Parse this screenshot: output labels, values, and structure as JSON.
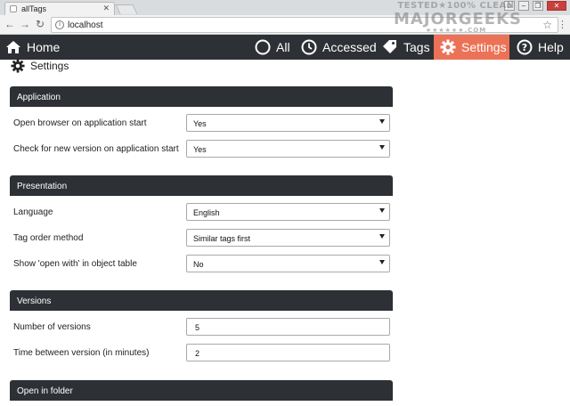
{
  "browser": {
    "tab_title": "allTags",
    "url": "localhost"
  },
  "watermark": {
    "line1": "TESTED★100% CLEAN",
    "line2": "MAJORGEEKS",
    "line3": "★★★★★★.COM"
  },
  "navbar": {
    "items": [
      {
        "label": "Home",
        "icon": "home-icon"
      },
      {
        "label": "All",
        "icon": "circle-icon"
      },
      {
        "label": "Accessed",
        "icon": "clock-icon"
      },
      {
        "label": "Tags",
        "icon": "tag-icon"
      },
      {
        "label": "Settings",
        "icon": "gear-icon",
        "active": true
      },
      {
        "label": "Help",
        "icon": "question-icon"
      }
    ],
    "active_color": "#ec7257",
    "bar_color": "#2d3035"
  },
  "page": {
    "title": "Settings"
  },
  "sections": {
    "application": {
      "title": "Application",
      "open_browser_label": "Open browser on application start",
      "open_browser_value": "Yes",
      "check_version_label": "Check for new version on application start",
      "check_version_value": "Yes"
    },
    "presentation": {
      "title": "Presentation",
      "language_label": "Language",
      "language_value": "English",
      "tag_order_label": "Tag order method",
      "tag_order_value": "Similar tags first",
      "open_with_label": "Show 'open with' in object table",
      "open_with_value": "No"
    },
    "versions": {
      "title": "Versions",
      "num_versions_label": "Number of versions",
      "num_versions_value": "5",
      "time_between_label": "Time between version (in minutes)",
      "time_between_value": "2"
    },
    "open_in_folder": {
      "title": "Open in folder"
    }
  }
}
